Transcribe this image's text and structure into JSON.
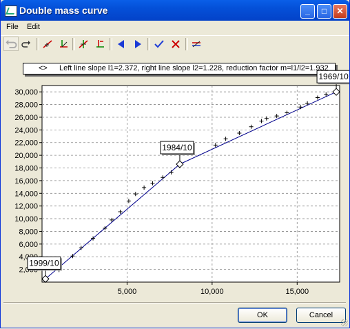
{
  "window": {
    "title": "Double mass curve",
    "minimize": "_",
    "maximize": "□",
    "close": "✕"
  },
  "menu": [
    "File",
    "Edit"
  ],
  "legend": {
    "symbol": "<>",
    "text": "Left line slope l1=2.372, right line slope l2=1.228, reduction factor m=l1/l2=1.932"
  },
  "buttons": {
    "ok": "OK",
    "cancel": "Cancel"
  },
  "colors": {
    "curve": "#00008b",
    "titlebar": "#0450d8",
    "points": "#000000"
  },
  "chart_data": {
    "type": "scatter",
    "xlim": [
      0,
      17500
    ],
    "ylim": [
      0,
      31000
    ],
    "x_ticks": [
      5000,
      10000,
      15000
    ],
    "x_tick_labels": [
      "5,000",
      "10,000",
      "15,000"
    ],
    "y_ticks": [
      2000,
      4000,
      6000,
      8000,
      10000,
      12000,
      14000,
      16000,
      18000,
      20000,
      22000,
      24000,
      26000,
      28000,
      30000
    ],
    "y_tick_labels": [
      "2,000",
      "4,000",
      "6,000",
      "8,000",
      "10,000",
      "12,000",
      "14,000",
      "16,000",
      "18,000",
      "20,000",
      "22,000",
      "24,000",
      "26,000",
      "28,000",
      "30,000"
    ],
    "grid": true,
    "series": [
      {
        "points": [
          [
            1000,
            1900
          ],
          [
            1800,
            4100
          ],
          [
            2300,
            5400
          ],
          [
            3000,
            6900
          ],
          [
            3700,
            8500
          ],
          [
            4100,
            9800
          ],
          [
            4600,
            11100
          ],
          [
            5100,
            12800
          ],
          [
            5500,
            13900
          ],
          [
            6000,
            14900
          ],
          [
            6500,
            15600
          ],
          [
            7100,
            16500
          ],
          [
            7600,
            17300
          ],
          [
            8100,
            18600
          ],
          [
            10200,
            21600
          ],
          [
            10800,
            22600
          ],
          [
            11600,
            23500
          ],
          [
            12300,
            24500
          ],
          [
            12900,
            25400
          ],
          [
            13200,
            25800
          ],
          [
            13800,
            26200
          ],
          [
            14400,
            26700
          ],
          [
            15200,
            27600
          ],
          [
            15600,
            28200
          ],
          [
            16200,
            29100
          ],
          [
            16700,
            29600
          ]
        ]
      }
    ],
    "fitted_lines": [
      {
        "from": [
          200,
          500
        ],
        "to": [
          8100,
          18600
        ]
      },
      {
        "from": [
          8100,
          18600
        ],
        "to": [
          17300,
          30000
        ]
      }
    ],
    "breakpoints": [
      {
        "label": "1999/10",
        "x": 200,
        "y": 500
      },
      {
        "label": "1984/10",
        "x": 8100,
        "y": 18600
      },
      {
        "label": "1969/10",
        "x": 17300,
        "y": 30000
      }
    ]
  }
}
